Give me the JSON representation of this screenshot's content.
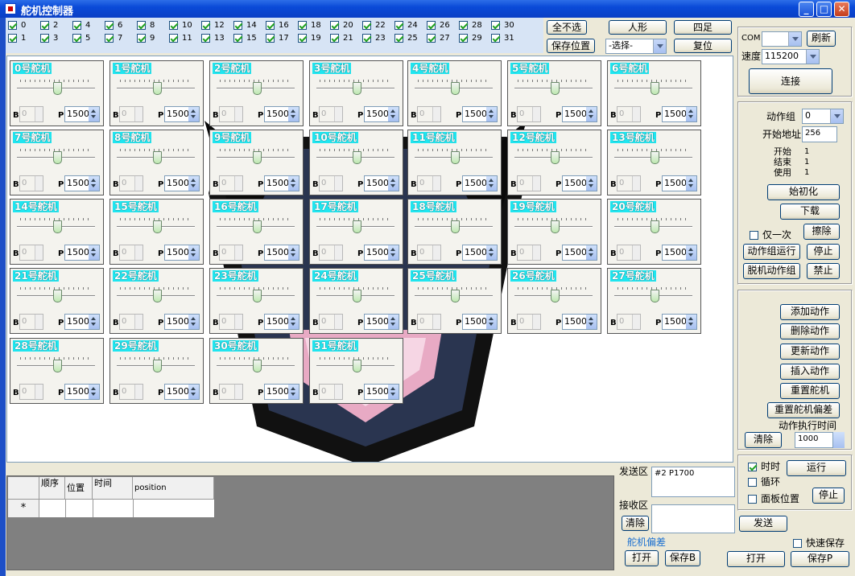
{
  "window": {
    "title": "舵机控制器",
    "min": "_",
    "max": "□",
    "close": "✕"
  },
  "channels": [
    {
      "n": "0",
      "on": true
    },
    {
      "n": "1",
      "on": true
    },
    {
      "n": "2",
      "on": true
    },
    {
      "n": "3",
      "on": true
    },
    {
      "n": "4",
      "on": true
    },
    {
      "n": "5",
      "on": true
    },
    {
      "n": "6",
      "on": true
    },
    {
      "n": "7",
      "on": true
    },
    {
      "n": "8",
      "on": true
    },
    {
      "n": "9",
      "on": true
    },
    {
      "n": "10",
      "on": true
    },
    {
      "n": "11",
      "on": true
    },
    {
      "n": "12",
      "on": true
    },
    {
      "n": "13",
      "on": true
    },
    {
      "n": "14",
      "on": true
    },
    {
      "n": "15",
      "on": true
    },
    {
      "n": "16",
      "on": true
    },
    {
      "n": "17",
      "on": true
    },
    {
      "n": "18",
      "on": true
    },
    {
      "n": "19",
      "on": true
    },
    {
      "n": "20",
      "on": true
    },
    {
      "n": "21",
      "on": true
    },
    {
      "n": "22",
      "on": true
    },
    {
      "n": "23",
      "on": true
    },
    {
      "n": "24",
      "on": true
    },
    {
      "n": "25",
      "on": true
    },
    {
      "n": "26",
      "on": true
    },
    {
      "n": "27",
      "on": true
    },
    {
      "n": "28",
      "on": true
    },
    {
      "n": "29",
      "on": true
    },
    {
      "n": "30",
      "on": true
    },
    {
      "n": "31",
      "on": true
    }
  ],
  "toolbar": {
    "deselect_all": "全不选",
    "humanoid": "人形",
    "quadruped": "四足",
    "save_position": "保存位置",
    "select_value": "-选择-",
    "reset": "复位"
  },
  "servos": [
    {
      "title": "0号舵机",
      "b": "0",
      "p": "1500"
    },
    {
      "title": "1号舵机",
      "b": "0",
      "p": "1500"
    },
    {
      "title": "2号舵机",
      "b": "0",
      "p": "1500"
    },
    {
      "title": "3号舵机",
      "b": "0",
      "p": "1500"
    },
    {
      "title": "4号舵机",
      "b": "0",
      "p": "1500"
    },
    {
      "title": "5号舵机",
      "b": "0",
      "p": "1500"
    },
    {
      "title": "6号舵机",
      "b": "0",
      "p": "1500"
    },
    {
      "title": "7号舵机",
      "b": "0",
      "p": "1500"
    },
    {
      "title": "8号舵机",
      "b": "0",
      "p": "1500"
    },
    {
      "title": "9号舵机",
      "b": "0",
      "p": "1500"
    },
    {
      "title": "10号舵机",
      "b": "0",
      "p": "1500"
    },
    {
      "title": "11号舵机",
      "b": "0",
      "p": "1500"
    },
    {
      "title": "12号舵机",
      "b": "0",
      "p": "1500"
    },
    {
      "title": "13号舵机",
      "b": "0",
      "p": "1500"
    },
    {
      "title": "14号舵机",
      "b": "0",
      "p": "1500"
    },
    {
      "title": "15号舵机",
      "b": "0",
      "p": "1500"
    },
    {
      "title": "16号舵机",
      "b": "0",
      "p": "1500"
    },
    {
      "title": "17号舵机",
      "b": "0",
      "p": "1500"
    },
    {
      "title": "18号舵机",
      "b": "0",
      "p": "1500"
    },
    {
      "title": "19号舵机",
      "b": "0",
      "p": "1500"
    },
    {
      "title": "20号舵机",
      "b": "0",
      "p": "1500"
    },
    {
      "title": "21号舵机",
      "b": "0",
      "p": "1500"
    },
    {
      "title": "22号舵机",
      "b": "0",
      "p": "1500"
    },
    {
      "title": "23号舵机",
      "b": "0",
      "p": "1500"
    },
    {
      "title": "24号舵机",
      "b": "0",
      "p": "1500"
    },
    {
      "title": "25号舵机",
      "b": "0",
      "p": "1500"
    },
    {
      "title": "26号舵机",
      "b": "0",
      "p": "1500"
    },
    {
      "title": "27号舵机",
      "b": "0",
      "p": "1500"
    },
    {
      "title": "28号舵机",
      "b": "0",
      "p": "1500"
    },
    {
      "title": "29号舵机",
      "b": "0",
      "p": "1500"
    },
    {
      "title": "30号舵机",
      "b": "0",
      "p": "1500"
    },
    {
      "title": "31号舵机",
      "b": "0",
      "p": "1500"
    }
  ],
  "labels": {
    "b": "B",
    "p": "P"
  },
  "connection": {
    "com_label": "COM",
    "com_value": "",
    "refresh": "刷新",
    "speed_label": "速度",
    "speed_value": "115200",
    "connect": "连接"
  },
  "action_group": {
    "group_label": "动作组",
    "group_value": "0",
    "start_addr_label": "开始地址",
    "start_addr_value": "256",
    "start_label": "开始",
    "start_value": "1",
    "end_label": "结束",
    "end_value": "1",
    "used_label": "使用",
    "used_value": "1",
    "init": "始初化",
    "download": "下载",
    "once_label": "仅一次",
    "erase": "擦除",
    "run_group": "动作组运行",
    "stop": "停止",
    "offline_group": "脱机动作组",
    "forbid": "禁止"
  },
  "actions": {
    "add": "添加动作",
    "delete": "删除动作",
    "update": "更新动作",
    "insert": "插入动作",
    "reset_servo": "重置舵机",
    "reset_offset": "重置舵机偏差",
    "exec_time_label": "动作执行时间",
    "clear": "清除",
    "exec_time_value": "1000"
  },
  "run_panel": {
    "time_label": "时时",
    "run": "运行",
    "loop_label": "循环",
    "panel_pos_label": "面板位置",
    "stop": "停止"
  },
  "grid": {
    "headers": [
      "顺序",
      "位置",
      "时间",
      "position"
    ],
    "new_row_marker": "*"
  },
  "comm": {
    "send_label": "发送区",
    "send_value": "#2 P1700",
    "recv_label": "接收区",
    "recv_value": "",
    "clear": "清除",
    "send": "发送",
    "offset_label": "舵机偏差",
    "open": "打开",
    "save_b": "保存B",
    "quick_save": "快速保存",
    "open2": "打开",
    "save_p": "保存P"
  },
  "colors": {
    "accent": "#1fe6f0",
    "titlebar": "#0a4ad8"
  }
}
